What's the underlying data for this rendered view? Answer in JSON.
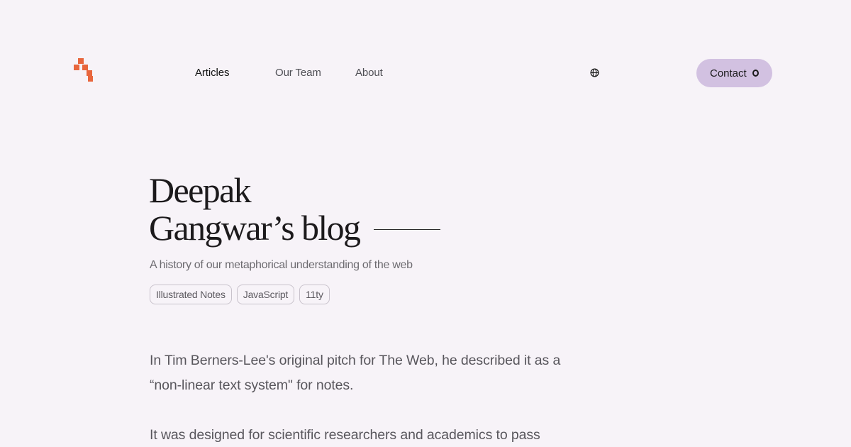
{
  "header": {
    "logo_icon": "stacked-squares-logo",
    "brand_color": "#e8663d",
    "nav": [
      {
        "label": "Articles",
        "active": true
      },
      {
        "label": "Our Team",
        "active": false
      },
      {
        "label": "About",
        "active": false
      }
    ],
    "language_icon": "globe-icon",
    "contact": {
      "label": "Contact",
      "bg": "#d2c1e1"
    }
  },
  "hero": {
    "title_line1": "Deepak",
    "title_line2": "Gangwar’s blog",
    "subtitle": "A history of our metaphorical understanding of the web",
    "tags": [
      "Illustrated Notes",
      "JavaScript",
      "11ty"
    ]
  },
  "content": {
    "paragraphs": [
      "In Tim Berners-Lee's original pitch for The Web, he described it as a “non-linear text system\" for notes.",
      "It was designed for scientific researchers and academics to pass"
    ]
  }
}
